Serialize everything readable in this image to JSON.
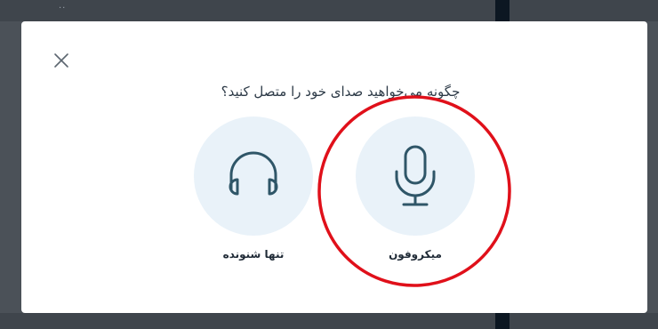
{
  "dialog": {
    "title": "چگونه می‌خواهید صدای خود را متصل کنید؟",
    "close_icon": "close-icon"
  },
  "options": [
    {
      "label": "میکروفون",
      "icon": "microphone-icon"
    },
    {
      "label": "تنها شنونده",
      "icon": "headphones-icon"
    }
  ],
  "colors": {
    "option_circle": "#e9f2f9",
    "icon_stroke": "#2f5668",
    "annotation": "#e0101a",
    "backdrop": "#4b5158"
  }
}
